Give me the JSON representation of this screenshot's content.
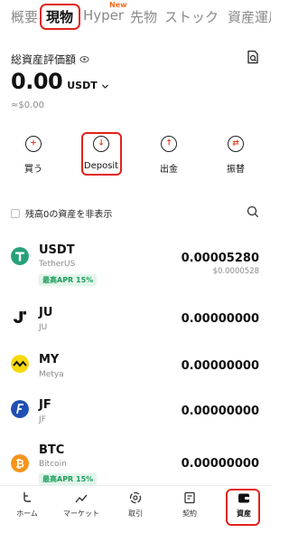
{
  "tabs": [
    {
      "label": "概要"
    },
    {
      "label": "現物"
    },
    {
      "label": "Hyper"
    },
    {
      "label": "先物"
    },
    {
      "label": "ストック"
    },
    {
      "label": "資産運用"
    }
  ],
  "new_badge": "New",
  "balance": {
    "label": "総資産評価額",
    "amount": "0.00",
    "unit": "USDT",
    "usd": "≈$0.00"
  },
  "actions": [
    {
      "label": "買う",
      "icon": "plus-circle-icon"
    },
    {
      "label": "Deposit",
      "icon": "deposit-icon"
    },
    {
      "label": "出金",
      "icon": "withdraw-icon"
    },
    {
      "label": "振替",
      "icon": "transfer-icon"
    }
  ],
  "hide_small_label": "残高0の資産を非表示",
  "assets": [
    {
      "symbol": "USDT",
      "name": "TetherUS",
      "apr": "最高APR 15%",
      "amount": "0.00005280",
      "value": "$0.0000528",
      "color": "#26a17b"
    },
    {
      "symbol": "JU",
      "name": "JU",
      "amount": "0.00000000",
      "color": "#111111"
    },
    {
      "symbol": "MY",
      "name": "Metya",
      "amount": "0.00000000",
      "color": "#f5d90a"
    },
    {
      "symbol": "JF",
      "name": "JF",
      "amount": "0.00000000",
      "color": "#1f4fb4"
    },
    {
      "symbol": "BTC",
      "name": "Bitcoin",
      "apr": "最高APR 15%",
      "amount": "0.00000000",
      "color": "#f7931a"
    }
  ],
  "nav": [
    {
      "label": "ホーム"
    },
    {
      "label": "マーケット"
    },
    {
      "label": "取引"
    },
    {
      "label": "契約"
    },
    {
      "label": "資産"
    }
  ],
  "colors": {
    "accent": "#e0241b",
    "apr_green": "#1e9e5b"
  }
}
